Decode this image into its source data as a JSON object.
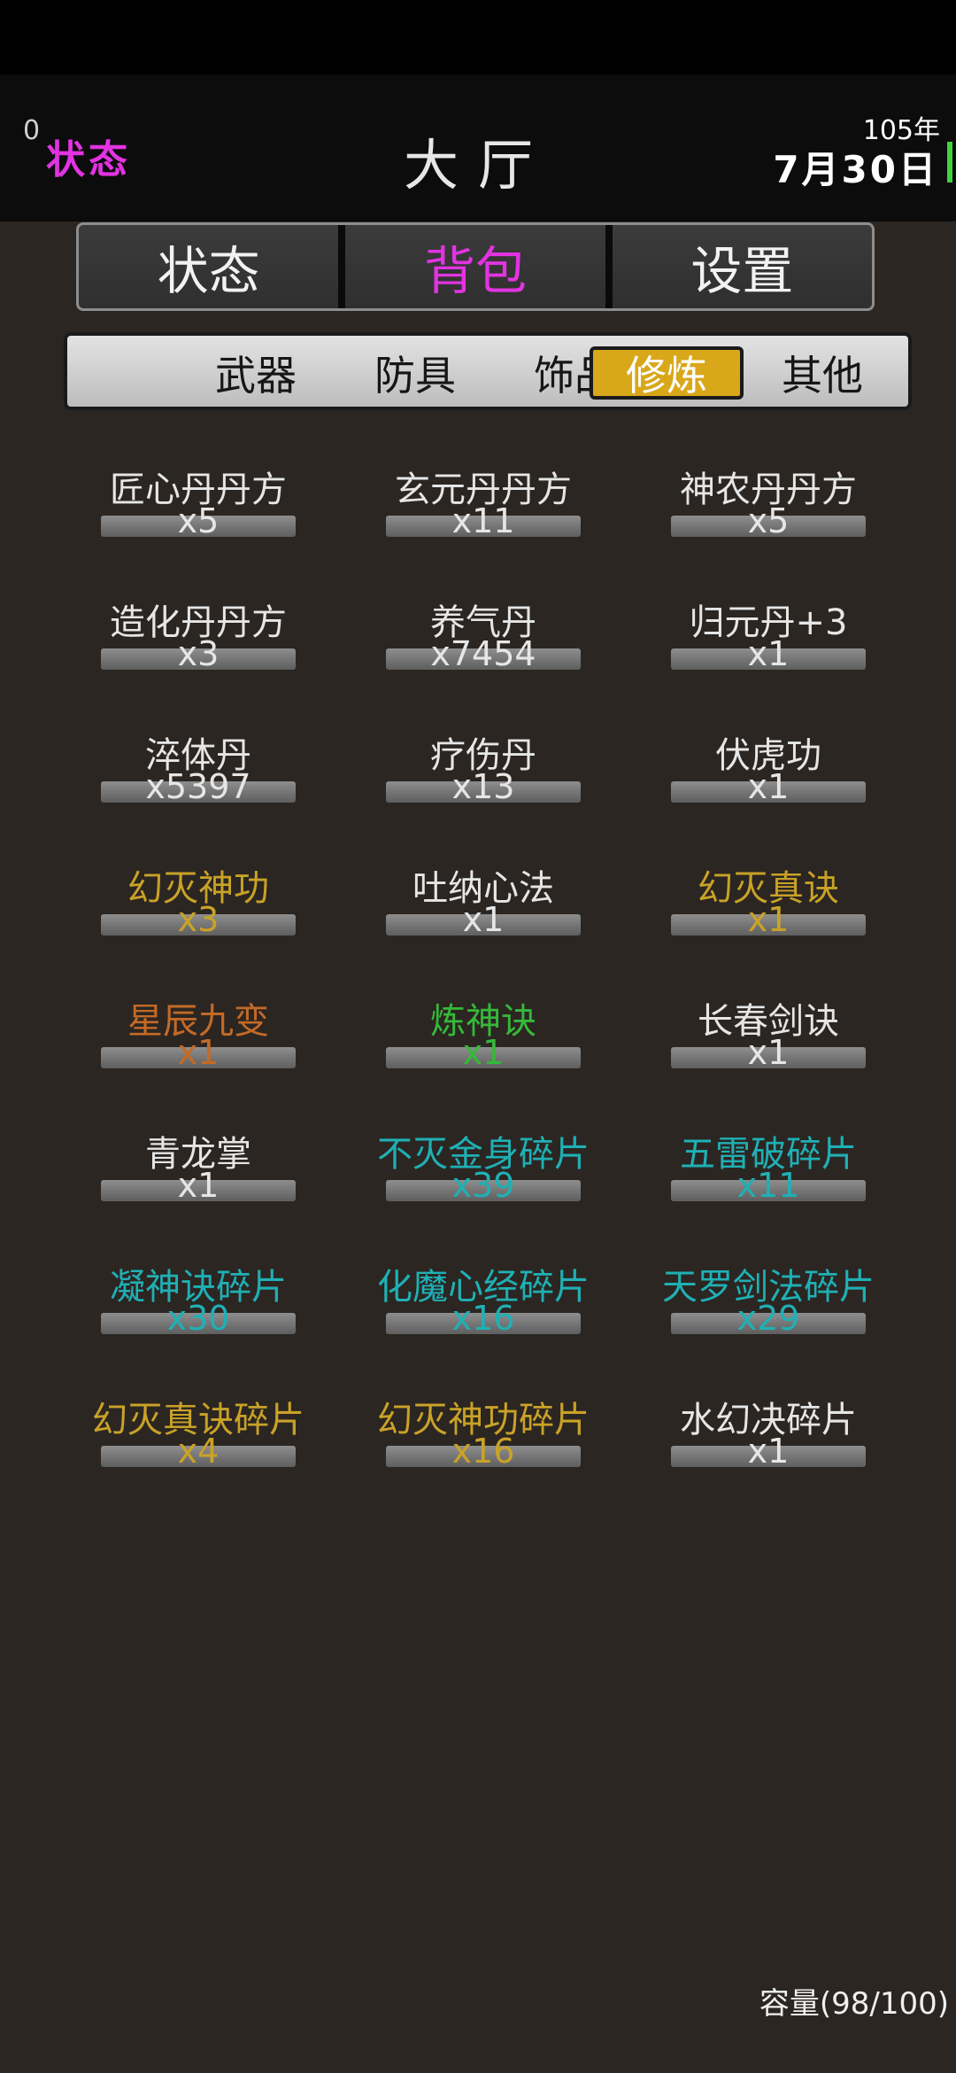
{
  "header": {
    "counter": "0",
    "status_label": "状态",
    "title": "大厅",
    "year": "105年",
    "date": "7月30日"
  },
  "main_tabs": [
    {
      "label": "状态"
    },
    {
      "label": "背包",
      "active": true
    },
    {
      "label": "设置"
    }
  ],
  "sub_tabs": [
    {
      "label": "武器"
    },
    {
      "label": "防具"
    },
    {
      "label": "饰品"
    },
    {
      "label": "修炼",
      "active": true
    },
    {
      "label": "其他"
    }
  ],
  "colors": {
    "white": "#e6e6e6",
    "gold": "#c9a227",
    "orange": "#c46a26",
    "green": "#35b93a",
    "cyan": "#1fb0b5",
    "magenta": "#e233e2"
  },
  "items": [
    {
      "name": "匠心丹丹方",
      "count": "x5",
      "color": "white"
    },
    {
      "name": "玄元丹丹方",
      "count": "x11",
      "color": "white"
    },
    {
      "name": "神农丹丹方",
      "count": "x5",
      "color": "white"
    },
    {
      "name": "造化丹丹方",
      "count": "x3",
      "color": "white"
    },
    {
      "name": "养气丹",
      "count": "x7454",
      "color": "white"
    },
    {
      "name": "归元丹+3",
      "count": "x1",
      "color": "white"
    },
    {
      "name": "淬体丹",
      "count": "x5397",
      "color": "white"
    },
    {
      "name": "疗伤丹",
      "count": "x13",
      "color": "white"
    },
    {
      "name": "伏虎功",
      "count": "x1",
      "color": "white"
    },
    {
      "name": "幻灭神功",
      "count": "x3",
      "color": "gold"
    },
    {
      "name": "吐纳心法",
      "count": "x1",
      "color": "white"
    },
    {
      "name": "幻灭真诀",
      "count": "x1",
      "color": "gold"
    },
    {
      "name": "星辰九变",
      "count": "x1",
      "color": "orange"
    },
    {
      "name": "炼神诀",
      "count": "x1",
      "color": "green"
    },
    {
      "name": "长春剑诀",
      "count": "x1",
      "color": "white"
    },
    {
      "name": "青龙掌",
      "count": "x1",
      "color": "white"
    },
    {
      "name": "不灭金身碎片",
      "count": "x39",
      "color": "cyan"
    },
    {
      "name": "五雷破碎片",
      "count": "x11",
      "color": "cyan"
    },
    {
      "name": "凝神诀碎片",
      "count": "x30",
      "color": "cyan"
    },
    {
      "name": "化魔心经碎片",
      "count": "x16",
      "color": "cyan"
    },
    {
      "name": "天罗剑法碎片",
      "count": "x29",
      "color": "cyan"
    },
    {
      "name": "幻灭真诀碎片",
      "count": "x4",
      "color": "gold"
    },
    {
      "name": "幻灭神功碎片",
      "count": "x16",
      "color": "gold"
    },
    {
      "name": "水幻决碎片",
      "count": "x1",
      "color": "white"
    }
  ],
  "footer": {
    "capacity": "容量(98/100)"
  }
}
